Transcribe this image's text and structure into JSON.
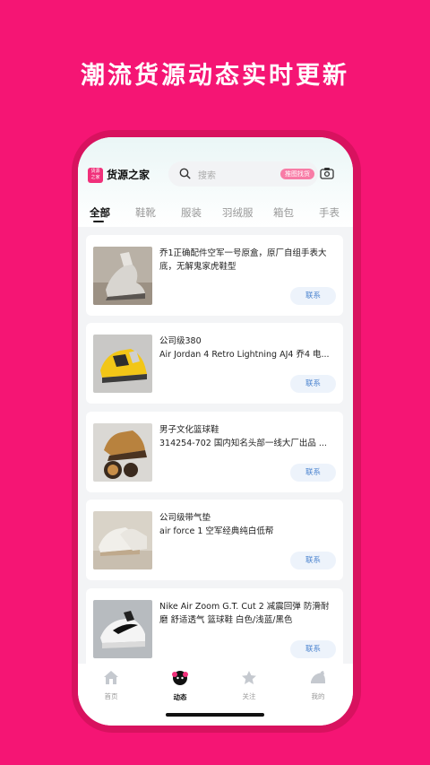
{
  "headline": "潮流货源动态实时更新",
  "app": {
    "logo_text_top": "货源",
    "logo_text_bottom": "之家",
    "brand_name": "货源之家",
    "search_placeholder": "搜索",
    "search_tag": "推图找货"
  },
  "tabs": [
    {
      "label": "全部",
      "active": true
    },
    {
      "label": "鞋靴",
      "active": false
    },
    {
      "label": "服装",
      "active": false
    },
    {
      "label": "羽绒服",
      "active": false
    },
    {
      "label": "箱包",
      "active": false
    },
    {
      "label": "手表",
      "active": false
    }
  ],
  "feed": [
    {
      "title_line1": "乔1正确配件空军一号原盒，原厂自组手表大",
      "title_line2": "底，无解鬼家虎鞋型",
      "contact": "联系",
      "thumb": "grey-sneaker"
    },
    {
      "title_line1": "公司级380",
      "title_line2": "Air Jordan 4 Retro Lightning AJ4 乔4 电...",
      "contact": "联系",
      "thumb": "yellow-sneaker"
    },
    {
      "title_line1": "男子文化篮球鞋",
      "title_line2": "314254-702 国内知名头部一线大厂出品 ...",
      "contact": "联系",
      "thumb": "brown-boot"
    },
    {
      "title_line1": "公司级带气垫",
      "title_line2": "air force 1 空军经典纯白低帮",
      "contact": "联系",
      "thumb": "white-sneaker"
    },
    {
      "title_line1": "Nike Air Zoom G.T. Cut  2 减震回弹 防滑耐",
      "title_line2": "磨 舒适透气 篮球鞋 白色/浅蓝/黑色",
      "contact": "联系",
      "thumb": "nike-white-black"
    }
  ],
  "bottom_nav": [
    {
      "label": "首页",
      "icon": "home-icon",
      "active": false
    },
    {
      "label": "动态",
      "icon": "feed-icon",
      "active": true
    },
    {
      "label": "关注",
      "icon": "star-icon",
      "active": false
    },
    {
      "label": "我的",
      "icon": "profile-icon",
      "active": false
    }
  ],
  "colors": {
    "background": "#F51574",
    "accent": "#F0307A",
    "contact_text": "#4E86D0"
  }
}
